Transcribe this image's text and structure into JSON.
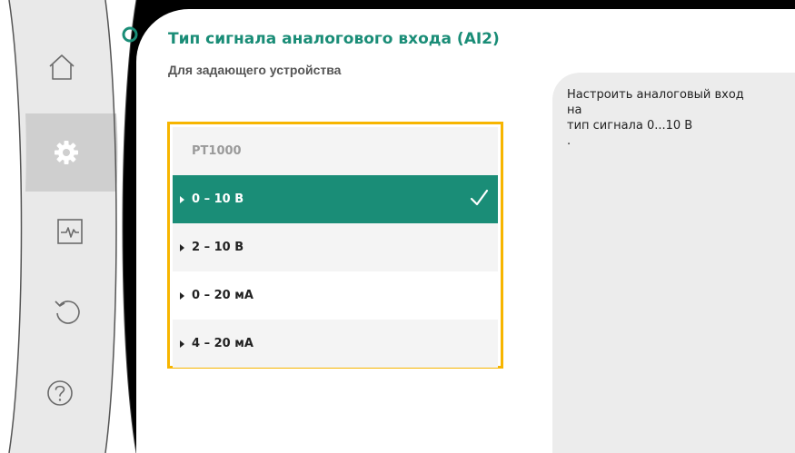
{
  "header": {
    "title": "Тип сигнала аналогового входа (AI2)",
    "subtitle": "Для задающего устройства"
  },
  "navigation": {
    "items": [
      {
        "name": "home",
        "icon": "home-icon",
        "active": false
      },
      {
        "name": "settings",
        "icon": "gear-icon",
        "active": true
      },
      {
        "name": "diagnostics",
        "icon": "pulse-monitor-icon",
        "active": false
      },
      {
        "name": "restore",
        "icon": "undo-icon",
        "active": false
      },
      {
        "name": "help",
        "icon": "help-icon",
        "active": false
      }
    ]
  },
  "options": {
    "items": [
      {
        "label": "PT1000",
        "disabled": true,
        "selected": false
      },
      {
        "label": "0 – 10 В",
        "disabled": false,
        "selected": true
      },
      {
        "label": "2 – 10 В",
        "disabled": false,
        "selected": false
      },
      {
        "label": "0 – 20 мА",
        "disabled": false,
        "selected": false
      },
      {
        "label": "4 – 20 мА",
        "disabled": false,
        "selected": false
      }
    ]
  },
  "help": {
    "lines": [
      "Настроить аналоговый вход",
      "на",
      "тип сигнала 0...10 В",
      "."
    ]
  },
  "colors": {
    "accent": "#1a8d77",
    "focus_border": "#f7b500",
    "nav_bg": "#e9e9e9",
    "nav_active": "#cfcfcf",
    "help_bg": "#ececec"
  }
}
